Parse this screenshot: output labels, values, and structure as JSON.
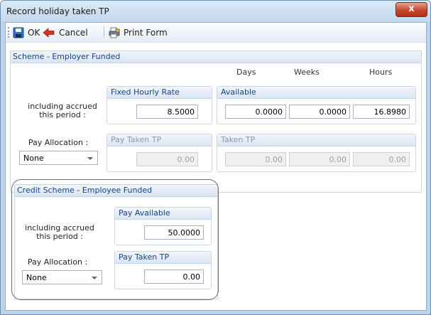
{
  "window": {
    "title": "Record holiday taken TP",
    "close_glyph": "x"
  },
  "toolbar": {
    "ok_label": "OK",
    "cancel_label": "Cancel",
    "print_label": "Print Form"
  },
  "scheme_employer": {
    "title": "Scheme - Employer Funded",
    "col_days": "Days",
    "col_weeks": "Weeks",
    "col_hours": "Hours",
    "accrued_label_1": "including accrued",
    "accrued_label_2": "this period :",
    "fixed_rate_title": "Fixed Hourly Rate",
    "fixed_rate_value": "8.5000",
    "available_title": "Available",
    "available_days": "0.0000",
    "available_weeks": "0.0000",
    "available_hours": "16.8980",
    "pay_allocation_label": "Pay Allocation :",
    "pay_allocation_value": "None",
    "pay_taken_title": "Pay Taken TP",
    "pay_taken_value": "0.00",
    "taken_title": "Taken TP",
    "taken_days": "0.00",
    "taken_weeks": "0.00",
    "taken_hours": "0.00"
  },
  "scheme_credit": {
    "title": "Credit Scheme - Employee Funded",
    "accrued_label_1": "including accrued",
    "accrued_label_2": "this period :",
    "pay_available_title": "Pay Available",
    "pay_available_value": "50.0000",
    "pay_allocation_label": "Pay Allocation :",
    "pay_allocation_value": "None",
    "pay_taken_title": "Pay Taken TP",
    "pay_taken_value": "0.00"
  },
  "colors": {
    "accent_text": "#15428b",
    "window_frame": "#bcd3ea",
    "close_button": "#c7452c"
  },
  "icons": {
    "ok": "save-disk-icon",
    "cancel": "back-arrow-icon",
    "print": "printer-icon"
  }
}
